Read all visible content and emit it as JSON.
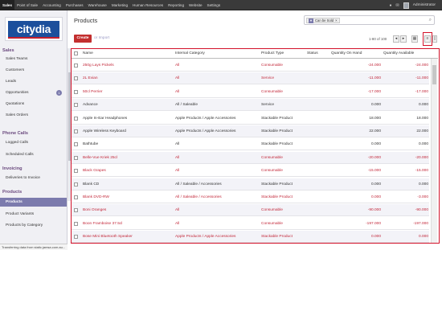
{
  "topbar": {
    "items": [
      "Sales",
      "Point of Sale",
      "Accounting",
      "Purchases",
      "Warehouse",
      "Marketing",
      "Human Resources",
      "Reporting",
      "Website",
      "Settings"
    ],
    "user": "Administrator"
  },
  "sidebar": {
    "logo_text": "citydia",
    "sections": [
      {
        "title": "Sales",
        "items": [
          "Sales Teams",
          "Customers",
          "Leads",
          "Opportunities",
          "Quotations",
          "Sales Orders"
        ]
      },
      {
        "title": "Phone Calls",
        "items": [
          "Logged Calls",
          "Scheduled Calls"
        ]
      },
      {
        "title": "Invoicing",
        "items": [
          "Deliveries to Invoice"
        ]
      },
      {
        "title": "Products",
        "items": [
          "Products",
          "Product Variants",
          "Products by Category"
        ]
      }
    ],
    "opportunities_badge": "1",
    "active_item": "Products",
    "status_text": "Transferring data from static.jamsa.com.au..."
  },
  "header": {
    "title": "Products",
    "search_facet": "Can be Sold",
    "create_label": "Create",
    "import_label": "or Import",
    "pager": "1-80 of 100"
  },
  "table": {
    "columns": [
      "Name",
      "Internal Category",
      "Product Type",
      "Status",
      "Quantity On Hand",
      "Quantity Available"
    ],
    "rows": [
      {
        "name": "250g Lays Pickels",
        "category": "All",
        "type": "Consumable",
        "status": "",
        "on_hand": "-24.000",
        "available": "-24.000",
        "red": true
      },
      {
        "name": "2L Evian",
        "category": "All",
        "type": "Service",
        "status": "",
        "on_hand": "-11.000",
        "available": "-11.000",
        "red": true
      },
      {
        "name": "50cl Perrier",
        "category": "All",
        "type": "Consumable",
        "status": "",
        "on_hand": "-17.000",
        "available": "-17.000",
        "red": true
      },
      {
        "name": "Advance",
        "category": "All / Saleable",
        "type": "Service",
        "status": "",
        "on_hand": "0.000",
        "available": "0.000",
        "red": false
      },
      {
        "name": "Apple In-Ear Headphones",
        "category": "Apple Products / Apple Accessories",
        "type": "Stackable Product",
        "status": "",
        "on_hand": "18.000",
        "available": "18.000",
        "red": false
      },
      {
        "name": "Apple Wireless Keyboard",
        "category": "Apple Products / Apple Accessories",
        "type": "Stackable Product",
        "status": "",
        "on_hand": "22.000",
        "available": "22.000",
        "red": false
      },
      {
        "name": "Bathtube",
        "category": "All",
        "type": "Stackable Product",
        "status": "",
        "on_hand": "0.000",
        "available": "0.000",
        "red": false
      },
      {
        "name": "Belle-Vue Kriek 25cl",
        "category": "All",
        "type": "Consumable",
        "status": "",
        "on_hand": "-20.000",
        "available": "-20.000",
        "red": true
      },
      {
        "name": "Black Grapes",
        "category": "All",
        "type": "Consumable",
        "status": "",
        "on_hand": "-15.000",
        "available": "-15.000",
        "red": true
      },
      {
        "name": "Blank CD",
        "category": "All / Saleable / Accessories",
        "type": "Stackable Product",
        "status": "",
        "on_hand": "0.000",
        "available": "0.000",
        "red": false
      },
      {
        "name": "Blank DVD-RW",
        "category": "All / Saleable / Accessories",
        "type": "Stackable Product",
        "status": "",
        "on_hand": "0.000",
        "available": "-3.000",
        "red": true
      },
      {
        "name": "Boni Oranges",
        "category": "All",
        "type": "Consumable",
        "status": "",
        "on_hand": "-90.000",
        "available": "-90.000",
        "red": true
      },
      {
        "name": "Boon Framboise 37.5cl",
        "category": "All",
        "type": "Consumable",
        "status": "",
        "on_hand": "-197.000",
        "available": "-197.000",
        "red": true
      },
      {
        "name": "Bose Mini Bluetooth Speaker",
        "category": "Apple Products / Apple Accessories",
        "type": "Stackable Product",
        "status": "",
        "on_hand": "0.000",
        "available": "0.000",
        "red": true
      }
    ]
  }
}
